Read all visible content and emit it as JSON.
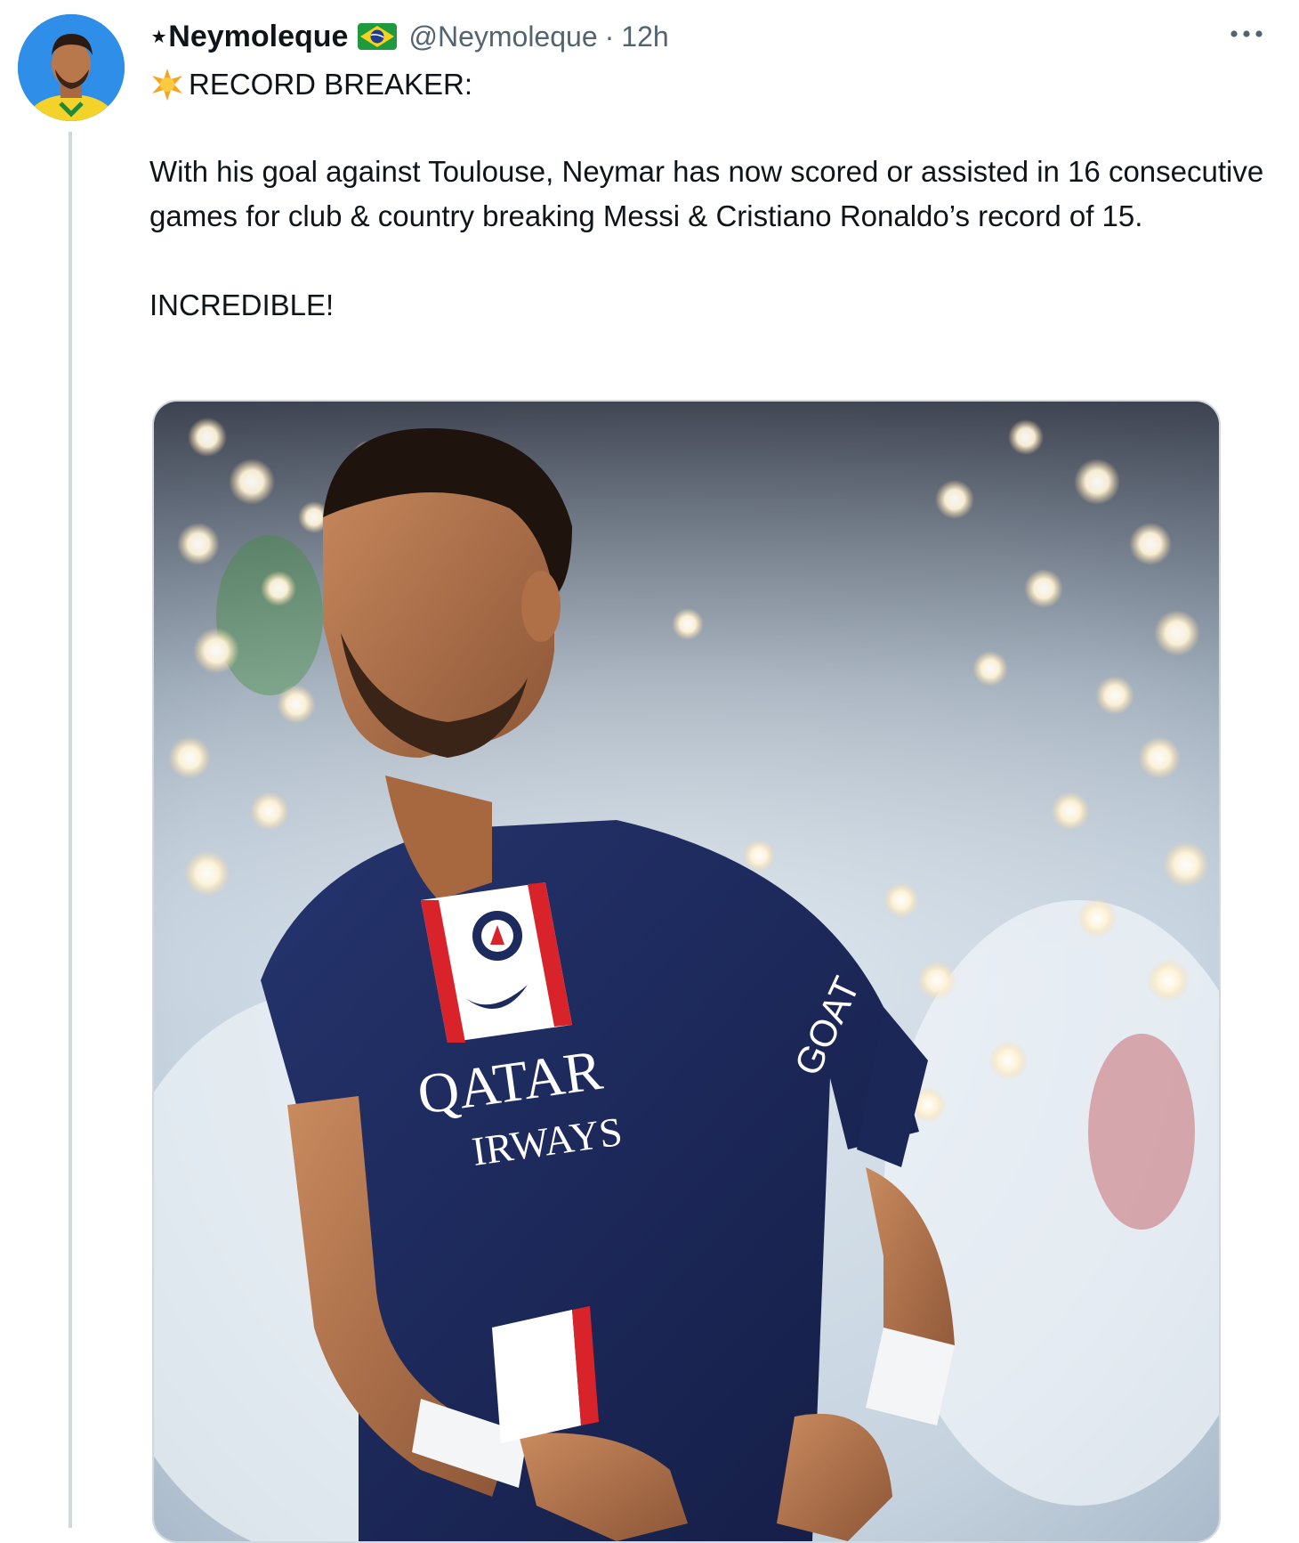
{
  "tweet": {
    "display_name": "⋆Neymoleque",
    "flag_icon": "brazil-flag-icon",
    "handle": "@Neymoleque",
    "separator": "·",
    "time": "12h",
    "more_icon": "more-options-icon",
    "text": {
      "headline_icon": "sparkle-star-icon",
      "headline": "RECORD BREAKER:",
      "body": "With his goal against Toulouse, Neymar has now scored or assisted in 16 consecutive games for club & country breaking Messi & Cristiano Ronaldo’s record of 15.",
      "closing": "INCREDIBLE!"
    },
    "media": {
      "jersey_sponsor_line1": "QATAR",
      "jersey_sponsor_line2": "IRWAYS",
      "sleeve_text": "GOAT"
    }
  },
  "colors": {
    "text_primary": "#0f1419",
    "text_secondary": "#536471",
    "border": "#cfd9de",
    "jersey_navy": "#1c2a5e",
    "jersey_red": "#d8232a"
  }
}
